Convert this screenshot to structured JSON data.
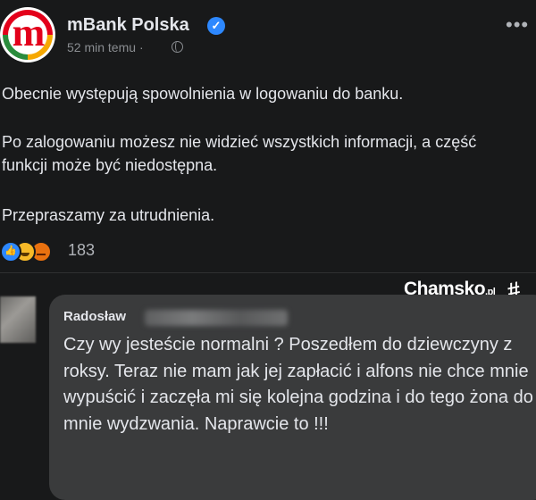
{
  "post": {
    "page_name": "mBank Polska",
    "timestamp": "52 min temu",
    "separator": "·",
    "more_label": "•••",
    "logo_letter": "m",
    "paragraphs": [
      "Obecnie występują spowolnienia w logowaniu do banku.",
      "Po zalogowaniu możesz nie widzieć wszystkich informacji, a część funkcji może być niedostępna.",
      "Przepraszamy za utrudnienia."
    ],
    "reactions": {
      "icons": [
        "like-icon",
        "haha-icon",
        "angry-icon"
      ],
      "count": "183"
    }
  },
  "watermark": {
    "name": "Chamsko",
    "suffix": ".pl",
    "symbol": "#"
  },
  "comment": {
    "author": "Radosław",
    "text": "Czy wy jesteście normalni ? Poszedłem do dziewczyny z roksy. Teraz nie mam jak jej zapłacić i alfons nie chce mnie wypuścić i zaczęła mi się kolejna godzina i do tego żona do mnie wydzwania. Naprawcie to !!!"
  },
  "colors": {
    "background": "#18191a",
    "comment_bubble": "#3a3b3c",
    "verified_badge": "#2d88ff",
    "brand_red": "#e3001b"
  }
}
